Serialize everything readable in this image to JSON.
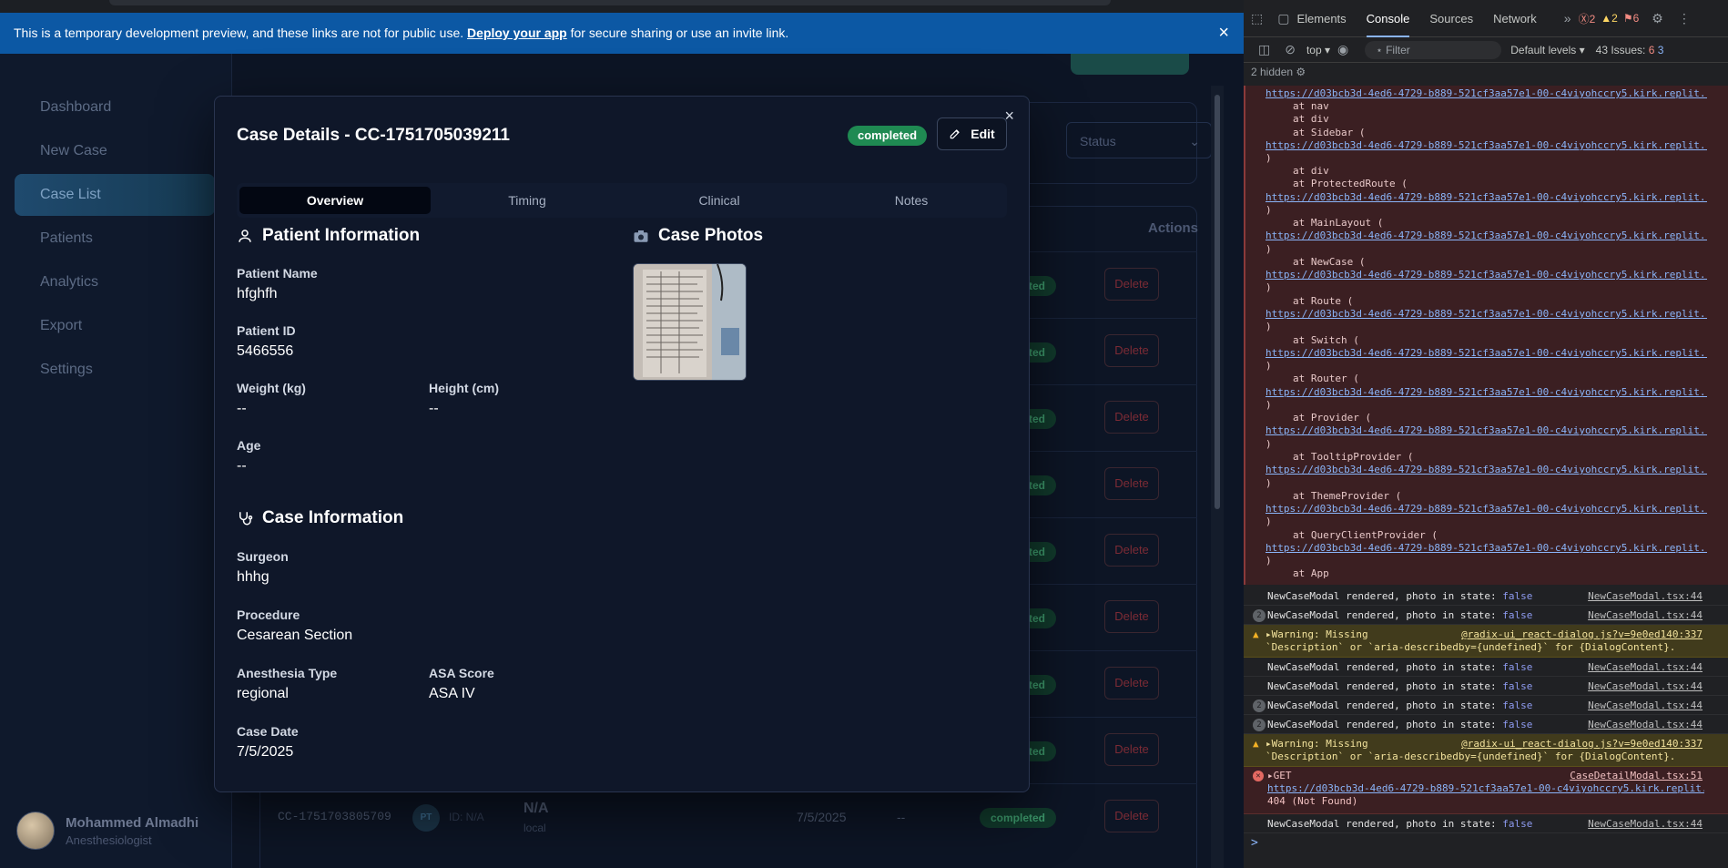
{
  "banner": {
    "text_before": "This is a temporary development preview, and these links are not for public use.",
    "link": "Deploy your app",
    "text_after": "for secure sharing or use an invite link.",
    "close": "×"
  },
  "sidebar": {
    "items": [
      {
        "label": "Dashboard"
      },
      {
        "label": "New Case"
      },
      {
        "label": "Case List"
      },
      {
        "label": "Patients"
      },
      {
        "label": "Analytics"
      },
      {
        "label": "Export"
      },
      {
        "label": "Settings"
      }
    ],
    "user": {
      "name": "Mohammed Almadhi",
      "role": "Anesthesiologist"
    }
  },
  "background_table": {
    "status_filter": "Status",
    "actions_header": "Actions",
    "row_badge": "completed",
    "row_delete": "Delete",
    "last_row": {
      "case_id": "CC-1751703805709",
      "initials": "PT",
      "patient_id": "ID: N/A",
      "name": "N/A",
      "anesthesia": "local",
      "date": "7/5/2025",
      "dash": "--"
    }
  },
  "modal": {
    "title": "Case Details - CC-1751705039211",
    "status": "completed",
    "edit_label": "Edit",
    "close": "×",
    "tabs": [
      "Overview",
      "Timing",
      "Clinical",
      "Notes"
    ],
    "patient_section": "Patient Information",
    "photos_section": "Case Photos",
    "case_section": "Case Information",
    "fields": {
      "patient_name_label": "Patient Name",
      "patient_name": "hfghfh",
      "patient_id_label": "Patient ID",
      "patient_id": "5466556",
      "weight_label": "Weight (kg)",
      "weight": "--",
      "height_label": "Height (cm)",
      "height": "--",
      "age_label": "Age",
      "age": "--",
      "surgeon_label": "Surgeon",
      "surgeon": "hhhg",
      "procedure_label": "Procedure",
      "procedure": "Cesarean Section",
      "anesthesia_label": "Anesthesia Type",
      "anesthesia": "regional",
      "asa_label": "ASA Score",
      "asa": "ASA IV",
      "date_label": "Case Date",
      "date": "7/5/2025"
    }
  },
  "devtools": {
    "tabs": [
      "Elements",
      "Console",
      "Sources",
      "Network"
    ],
    "counts": {
      "errors": "2",
      "warnings": "2",
      "issues_badge": "6"
    },
    "context": "top",
    "filter_placeholder": "Filter",
    "levels": "Default levels",
    "issues": "43 Issues:",
    "issues_count": "6",
    "issues_count2": "3",
    "hidden": "2 hidden",
    "url": "https://d03bcb3d-4ed6-4729-b889-521cf3aa57e1-00-c4viyohccry5.kirk.replit...",
    "stack": [
      "at nav",
      "at div",
      "at Sidebar (",
      ")",
      "at div",
      "at ProtectedRoute (",
      ")",
      "at MainLayout (",
      ")",
      "at NewCase (",
      ")",
      "at Route (",
      ")",
      "at Switch (",
      ")",
      "at Router (",
      ")",
      "at Provider (",
      ")",
      "at TooltipProvider (",
      ")",
      "at ThemeProvider (",
      ")",
      "at QueryClientProvider (",
      ")",
      "at App"
    ],
    "log_msg": "NewCaseModal rendered, photo in state:",
    "log_val": "false",
    "log_src": "NewCaseModal.tsx:44",
    "warn_l1": "▸Warning: Missing",
    "warn_l2": "`Description` or `aria-describedby={undefined}` for {DialogContent}.",
    "warn_src": "@radix-ui_react-dialog.js?v=9e0ed140:337",
    "get_label": "▸GET",
    "get_src": "CaseDetailModal.tsx:51",
    "get_status": "404 (Not Found)",
    "count2": "2",
    "prompt": ">"
  }
}
